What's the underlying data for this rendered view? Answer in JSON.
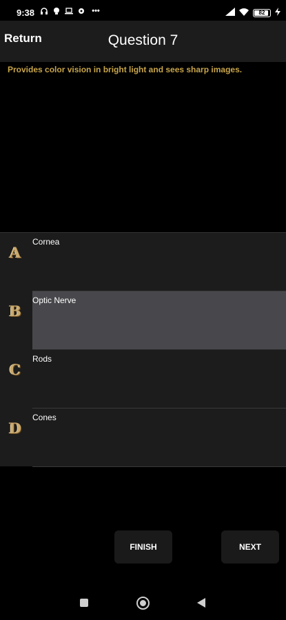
{
  "status_bar": {
    "time": "9:38",
    "battery": "82",
    "icons_left": [
      "headphones-icon",
      "notification-icon",
      "laptop-icon",
      "gear-icon",
      "more-icon"
    ],
    "icons_right": [
      "signal-icon",
      "wifi-icon",
      "battery-icon",
      "charging-icon"
    ]
  },
  "header": {
    "return_label": "Return",
    "title": "Question 7"
  },
  "question": {
    "text": "Provides color vision in bright light and sees sharp images."
  },
  "answers": [
    {
      "letter": "A",
      "label": "Cornea",
      "selected": false
    },
    {
      "letter": "B",
      "label": "Optic Nerve",
      "selected": true
    },
    {
      "letter": "C",
      "label": "Rods",
      "selected": false
    },
    {
      "letter": "D",
      "label": "Cones",
      "selected": false
    }
  ],
  "buttons": {
    "finish": "FINISH",
    "next": "NEXT"
  },
  "colors": {
    "question_text": "#c8a54a",
    "letter": "#c9a96e",
    "selected_bg": "#48484c"
  }
}
